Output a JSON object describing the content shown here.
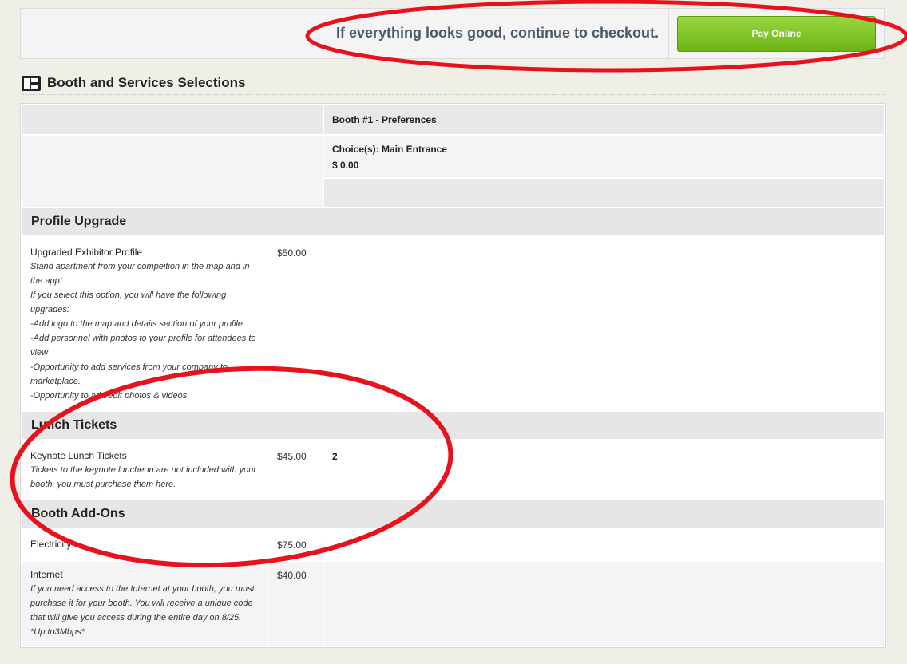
{
  "top": {
    "message": "If everything looks good, continue to checkout.",
    "pay_button": "Pay Online"
  },
  "section": {
    "title": "Booth and Services Selections",
    "icon": "layout-icon"
  },
  "booth": {
    "header": "Booth #1 - Preferences",
    "choice": "Choice(s): Main Entrance",
    "price": "$ 0.00"
  },
  "categories": {
    "profile": "Profile Upgrade",
    "lunch": "Lunch Tickets",
    "addons": "Booth Add-Ons"
  },
  "items": {
    "profile": {
      "name": "Upgraded Exhibitor Profile",
      "price": "$50.00",
      "desc": [
        "Stand apartment from your compeition in the map and in",
        "the app!",
        "If you select this option, you will have the following",
        "upgrades:",
        "-Add logo to the map and details section of your profile",
        "-Add personnel with photos to your profile for attendees to",
        "view",
        "-Opportunity to add services from your company to",
        "marketplace.",
        "-Opportunity to add/edit photos & videos"
      ]
    },
    "lunch": {
      "name": "Keynote Lunch Tickets",
      "price": "$45.00",
      "qty": "2",
      "desc": [
        "Tickets to the keynote luncheon are not included with your",
        "booth, you must purchase them here."
      ]
    },
    "electricity": {
      "name": "Electricity",
      "price": "$75.00"
    },
    "internet": {
      "name": "Internet",
      "price": "$40.00",
      "desc": [
        "If you need access to the Internet at your booth, you must",
        "purchase it for your booth. You will receive a unique code",
        "that will give you access during the entire day on 8/25.",
        "*Up to3Mbps*"
      ]
    }
  },
  "annotation_color": "#e8121d"
}
